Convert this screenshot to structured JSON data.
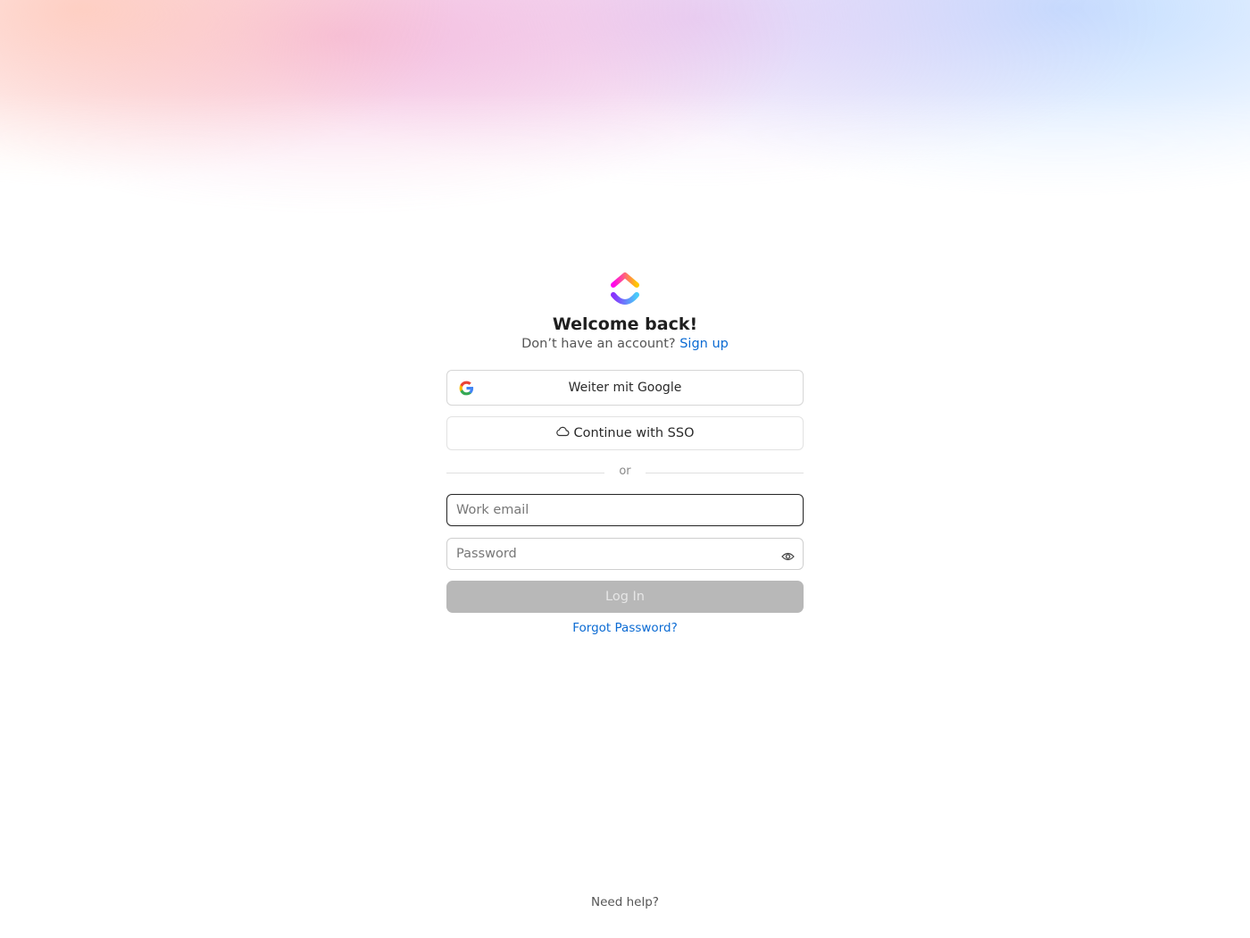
{
  "header": {
    "title": "Welcome back!",
    "subtitle_text": "Don’t have an account?",
    "signup_link": "Sign up"
  },
  "auth": {
    "google_button": "Weiter mit Google",
    "sso_button": "Continue with SSO",
    "divider_text": "or"
  },
  "form": {
    "email_placeholder": "Work email",
    "password_placeholder": "Password",
    "login_button": "Log In",
    "forgot_password": "Forgot Password?"
  },
  "footer": {
    "help_text": "Need help?"
  },
  "icons": {
    "logo": "clickup-logo",
    "google": "google-icon",
    "sso": "cloud-icon",
    "password_toggle": "eye-icon"
  },
  "colors": {
    "link": "#0b6bd3",
    "login_disabled": "#b8b8b8",
    "focus_border": "#2a2a2a"
  }
}
